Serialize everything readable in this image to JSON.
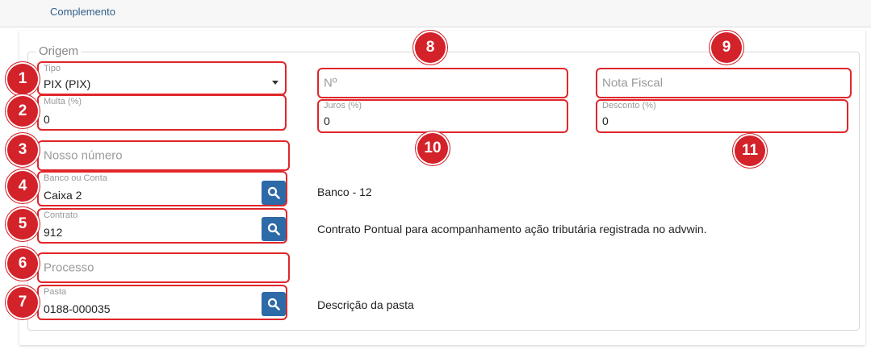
{
  "tabs": {
    "complemento": "Complemento"
  },
  "section": {
    "legend": "Origem"
  },
  "fields": {
    "tipo": {
      "label": "Tipo",
      "value": "PIX (PIX)"
    },
    "numero": {
      "placeholder": "Nº"
    },
    "nota_fiscal": {
      "placeholder": "Nota Fiscal"
    },
    "multa": {
      "label": "Multa (%)",
      "value": "0"
    },
    "juros": {
      "label": "Juros (%)",
      "value": "0"
    },
    "desconto": {
      "label": "Desconto (%)",
      "value": "0"
    },
    "nosso_numero": {
      "placeholder": "Nosso número"
    },
    "banco": {
      "label": "Banco ou Conta",
      "value": "Caixa 2",
      "description": "Banco - 12"
    },
    "contrato": {
      "label": "Contrato",
      "value": "912",
      "description": "Contrato Pontual para acompanhamento ação tributária registrada no advwin."
    },
    "processo": {
      "placeholder": "Processo"
    },
    "pasta": {
      "label": "Pasta",
      "value": "0188-000035",
      "description": "Descrição da pasta"
    }
  },
  "badges": [
    "1",
    "2",
    "3",
    "4",
    "5",
    "6",
    "7",
    "8",
    "9",
    "10",
    "11"
  ],
  "colors": {
    "highlight": "#e0262a",
    "badge": "#d3222a",
    "search_button": "#2d6aa8",
    "link": "#2f5f8a"
  },
  "icons": {
    "search": "search-icon",
    "dropdown": "chevron-down-icon"
  }
}
